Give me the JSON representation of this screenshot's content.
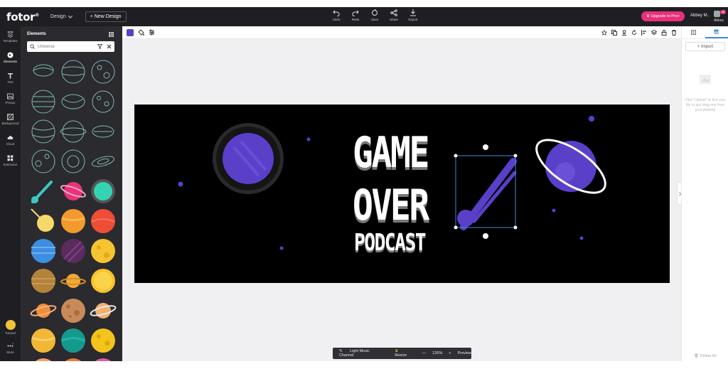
{
  "header": {
    "logo": "fotor",
    "design_menu": "Design",
    "new_design": "+ New Design",
    "tools": [
      {
        "label": "Undo",
        "icon": "undo-icon"
      },
      {
        "label": "Redo",
        "icon": "redo-icon"
      },
      {
        "label": "Save",
        "icon": "save-icon"
      },
      {
        "label": "Share",
        "icon": "share-icon"
      },
      {
        "label": "Export",
        "icon": "export-icon"
      }
    ],
    "upgrade": "Upgrade to Pro+",
    "user_name": "Abbey M..",
    "avatar_name": "Abbey",
    "notification_count": "35"
  },
  "sidebar": {
    "items": [
      {
        "label": "Templates",
        "icon": "templates-icon"
      },
      {
        "label": "Elements",
        "icon": "elements-icon"
      },
      {
        "label": "Text",
        "icon": "text-icon"
      },
      {
        "label": "Photos",
        "icon": "photos-icon"
      },
      {
        "label": "Background",
        "icon": "background-icon"
      },
      {
        "label": "Cloud",
        "icon": "cloud-icon"
      },
      {
        "label": "Extension",
        "icon": "extension-icon"
      }
    ],
    "tutorial": "Tutorial",
    "more": "More"
  },
  "elements_panel": {
    "title": "Elements",
    "search_value": "Universe"
  },
  "canvas": {
    "text_line1": "GAME",
    "text_line2": "OVER",
    "text_line3": "PODCAST",
    "background": "#000000",
    "accent": "#5a3fc9"
  },
  "bottom_bar": {
    "channel": "Light Music Channel",
    "resize": "Resize",
    "zoom_minus": "—",
    "zoom": "126%",
    "zoom_plus": "+",
    "preview": "Preview"
  },
  "right_panel": {
    "import": "+ Import",
    "hint": "Click \"Upload\" to find your file or just drag one from your desktop",
    "delete_all": "Delete All"
  }
}
